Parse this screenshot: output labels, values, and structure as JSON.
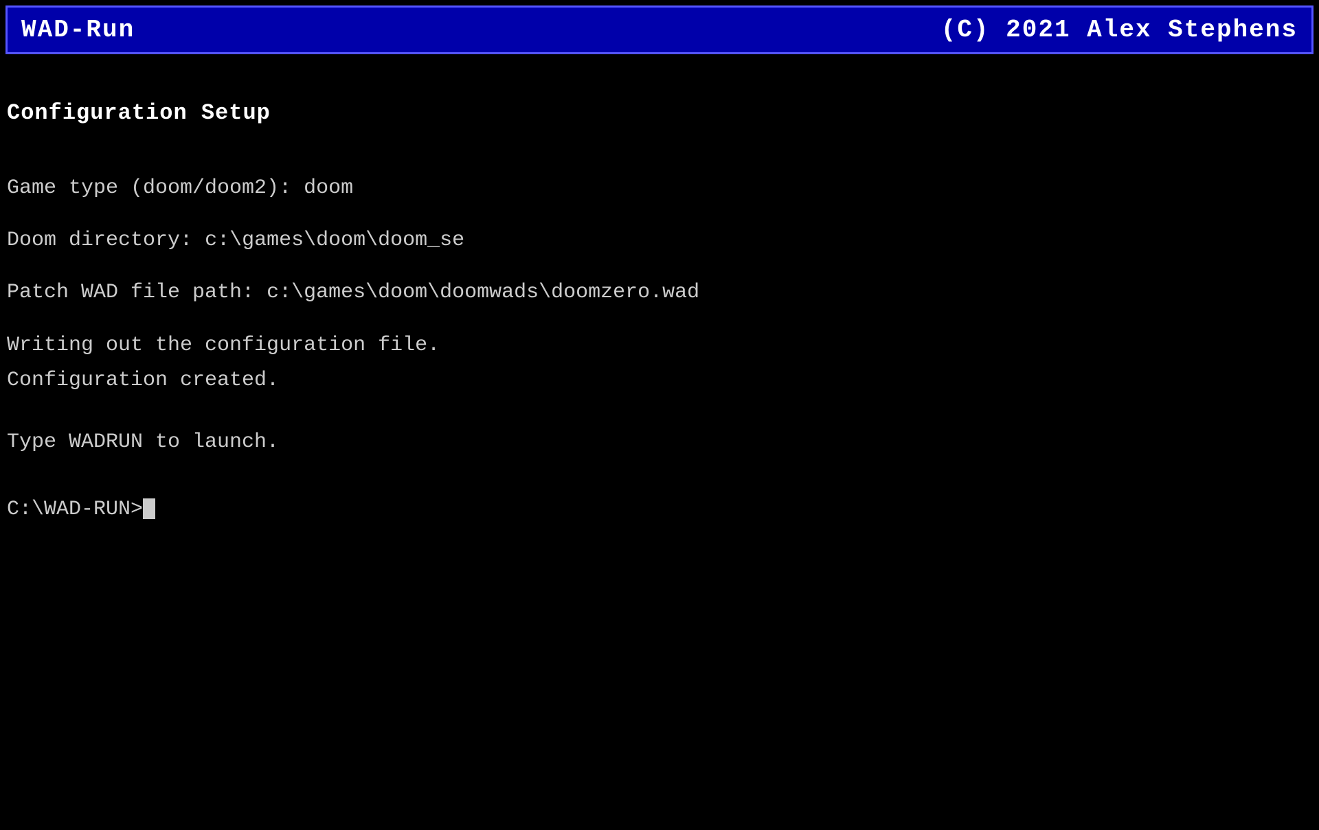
{
  "titlebar": {
    "app_name": "WAD-Run",
    "copyright": "(C) 2021 Alex Stephens"
  },
  "main": {
    "section_title": "Configuration Setup",
    "game_type_label": "Game type (doom/doom2):",
    "game_type_value": "doom",
    "doom_directory_label": "Doom directory:",
    "doom_directory_value": "c:\\games\\doom\\doom_se",
    "patch_wad_label": "Patch WAD file path:",
    "patch_wad_value": "c:\\games\\doom\\doomwads\\doomzero.wad",
    "status_line1": "Writing out the configuration file.",
    "status_line2": "Configuration created.",
    "launch_instruction": "Type WADRUN to launch.",
    "prompt": "C:\\WAD-RUN>_"
  }
}
